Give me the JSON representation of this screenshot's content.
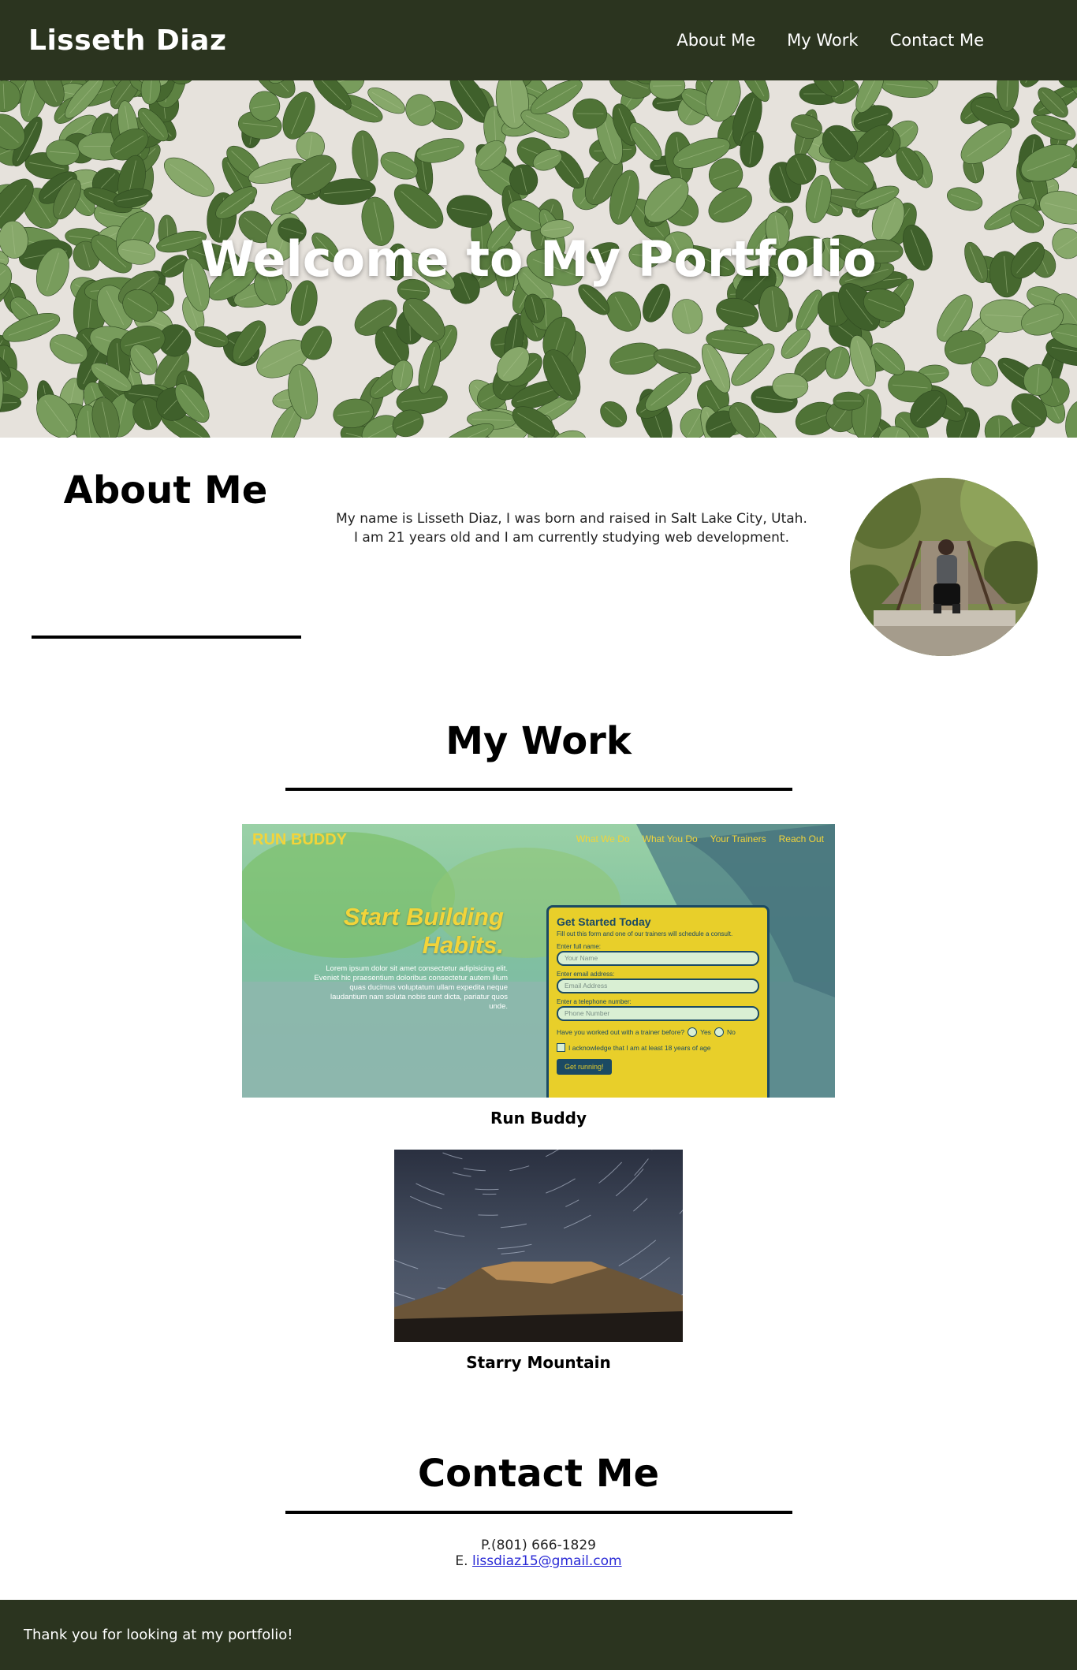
{
  "header": {
    "site_title": "Lisseth Diaz",
    "nav": [
      {
        "label": "About Me"
      },
      {
        "label": "My Work"
      },
      {
        "label": "Contact Me"
      }
    ]
  },
  "hero": {
    "title": "Welcome to My Portfolio",
    "image": "green-leaves-on-white-wall"
  },
  "about": {
    "heading": "About Me",
    "text": "My name is Lisseth Diaz, I was born and raised in Salt Lake City, Utah. I am 21 years old and I am currently studying web development.",
    "photo": "profile-photo-on-bridge"
  },
  "work": {
    "heading": "My Work",
    "projects": [
      {
        "title": "Run Buddy",
        "screenshot": {
          "brand": "RUN BUDDY",
          "nav": [
            "What We Do",
            "What You Do",
            "Your Trainers",
            "Reach Out"
          ],
          "headline_1": "Start Building",
          "headline_2": "Habits.",
          "lorem": "Lorem ipsum dolor sit amet consectetur adipisicing elit. Eveniet hic praesentium doloribus consectetur autem illum quas ducimus voluptatum ullam expedita neque laudantium nam soluta nobis sunt dicta, pariatur quos unde.",
          "form_title": "Get Started Today",
          "form_subtitle": "Fill out this form and one of our trainers will schedule a consult.",
          "name_label": "Enter full name:",
          "name_placeholder": "Your Name",
          "email_label": "Enter email address:",
          "email_placeholder": "Email Address",
          "phone_label": "Enter a telephone number:",
          "phone_placeholder": "Phone Number",
          "trainer_question": "Have you worked out with a trainer before?",
          "yes": "Yes",
          "no": "No",
          "age_check": "I acknowledge that I am at least 18 years of age",
          "submit": "Get running!"
        }
      },
      {
        "title": "Starry Mountain",
        "image": "star-trails-over-mesa"
      }
    ]
  },
  "contact": {
    "heading": "Contact Me",
    "phone_line": "P.(801) 666-1829",
    "email_prefix": "E.",
    "email": "lissdiaz15@gmail.com"
  },
  "footer": {
    "text": "Thank you for looking at my portfolio!"
  },
  "colors": {
    "header_bg": "#2b341f",
    "footer_bg": "#2b341f",
    "link": "#2a2ad6",
    "run_buddy_yellow": "#f2d43a"
  }
}
